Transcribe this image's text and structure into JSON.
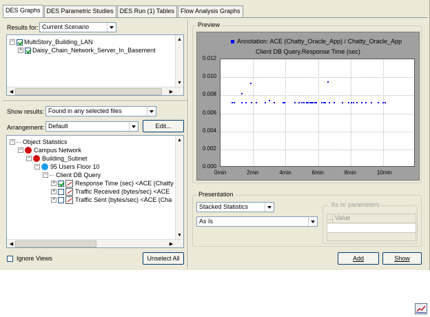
{
  "tabs": [
    "DES Graphs",
    "DES Parametric Studies",
    "DES Run (1) Tables",
    "Flow Analysis Graphs"
  ],
  "results_for": {
    "label": "Results for:",
    "value": "Current Scenario"
  },
  "scenario_tree": [
    "MultiStory_Building_LAN",
    "Daisy_Chain_Network_Server_In_Basement"
  ],
  "show_results": {
    "label": "Show results:",
    "value": "Found in any selected files"
  },
  "arrangement": {
    "label": "Arrangement:",
    "value": "Default",
    "edit_button": "Edit..."
  },
  "stats_tree": {
    "root": "Object Statistics",
    "campus": "Campus Network",
    "building": "Building_Subnet",
    "users": "95 Users Floor 10",
    "query": "Client DB Query",
    "stats": [
      {
        "label": "Response Time (sec) <ACE (Chatty",
        "checked": true
      },
      {
        "label": "Traffic Received (bytes/sec) <ACE",
        "checked": false
      },
      {
        "label": "Traffic Sent (bytes/sec) <ACE (Cha",
        "checked": false
      }
    ]
  },
  "ignore_views": "Ignore Views",
  "unselect_all": "Unselect All",
  "preview": {
    "title": "Preview",
    "legend": "Annotation: ACE (Chatty_Oracle_App) / Chatty_Oracle_App",
    "chart_title": "Client DB Query.Response Time (sec)"
  },
  "chart_data": {
    "type": "scatter",
    "title": "Client DB Query.Response Time (sec)",
    "legend": [
      "Annotation: ACE (Chatty_Oracle_App) / Chatty_Oracle_App"
    ],
    "xlim": [
      0,
      12
    ],
    "ylim": [
      0,
      0.012
    ],
    "x_ticks": [
      "0min",
      "2min",
      "4min",
      "6min",
      "8min",
      "10min"
    ],
    "y_ticks": [
      "0.000",
      "0.002",
      "0.004",
      "0.006",
      "0.008",
      "0.010",
      "0.012"
    ],
    "grid": true,
    "color": "#0000ff",
    "points": [
      [
        0.7,
        0.0072
      ],
      [
        0.85,
        0.0072
      ],
      [
        1.3,
        0.0082
      ],
      [
        1.3,
        0.0072
      ],
      [
        1.55,
        0.0072
      ],
      [
        1.85,
        0.0093
      ],
      [
        1.9,
        0.0072
      ],
      [
        2.2,
        0.0072
      ],
      [
        2.75,
        0.0072
      ],
      [
        3.0,
        0.0074
      ],
      [
        3.3,
        0.0072
      ],
      [
        3.85,
        0.0072
      ],
      [
        3.95,
        0.0072
      ],
      [
        4.6,
        0.0072
      ],
      [
        4.85,
        0.0072
      ],
      [
        5.0,
        0.0072
      ],
      [
        5.15,
        0.0072
      ],
      [
        5.3,
        0.0072
      ],
      [
        5.4,
        0.0072
      ],
      [
        5.5,
        0.0072
      ],
      [
        5.6,
        0.0072
      ],
      [
        5.7,
        0.0072
      ],
      [
        5.8,
        0.0072
      ],
      [
        5.9,
        0.0072
      ],
      [
        6.25,
        0.0072
      ],
      [
        6.35,
        0.0072
      ],
      [
        6.45,
        0.0072
      ],
      [
        6.6,
        0.0095
      ],
      [
        6.7,
        0.0072
      ],
      [
        7.0,
        0.0072
      ],
      [
        7.5,
        0.0072
      ],
      [
        7.9,
        0.0072
      ],
      [
        8.05,
        0.0072
      ],
      [
        8.2,
        0.0072
      ],
      [
        8.4,
        0.0072
      ],
      [
        8.7,
        0.0072
      ],
      [
        8.95,
        0.0072
      ],
      [
        9.3,
        0.0072
      ],
      [
        9.7,
        0.0072
      ],
      [
        10.0,
        0.0072
      ],
      [
        10.15,
        0.0072
      ]
    ]
  },
  "presentation": {
    "title": "Presentation",
    "mode": "Stacked Statistics",
    "transform": "As Is",
    "params_title": "'As Is' parameters",
    "params_col_marker": "...",
    "params_col": "Value"
  },
  "add_button": "Add",
  "show_button": "Show",
  "icons": {
    "chart": "chart-icon",
    "red_node": "#d01010",
    "blue_node": "#1aa0e8"
  }
}
